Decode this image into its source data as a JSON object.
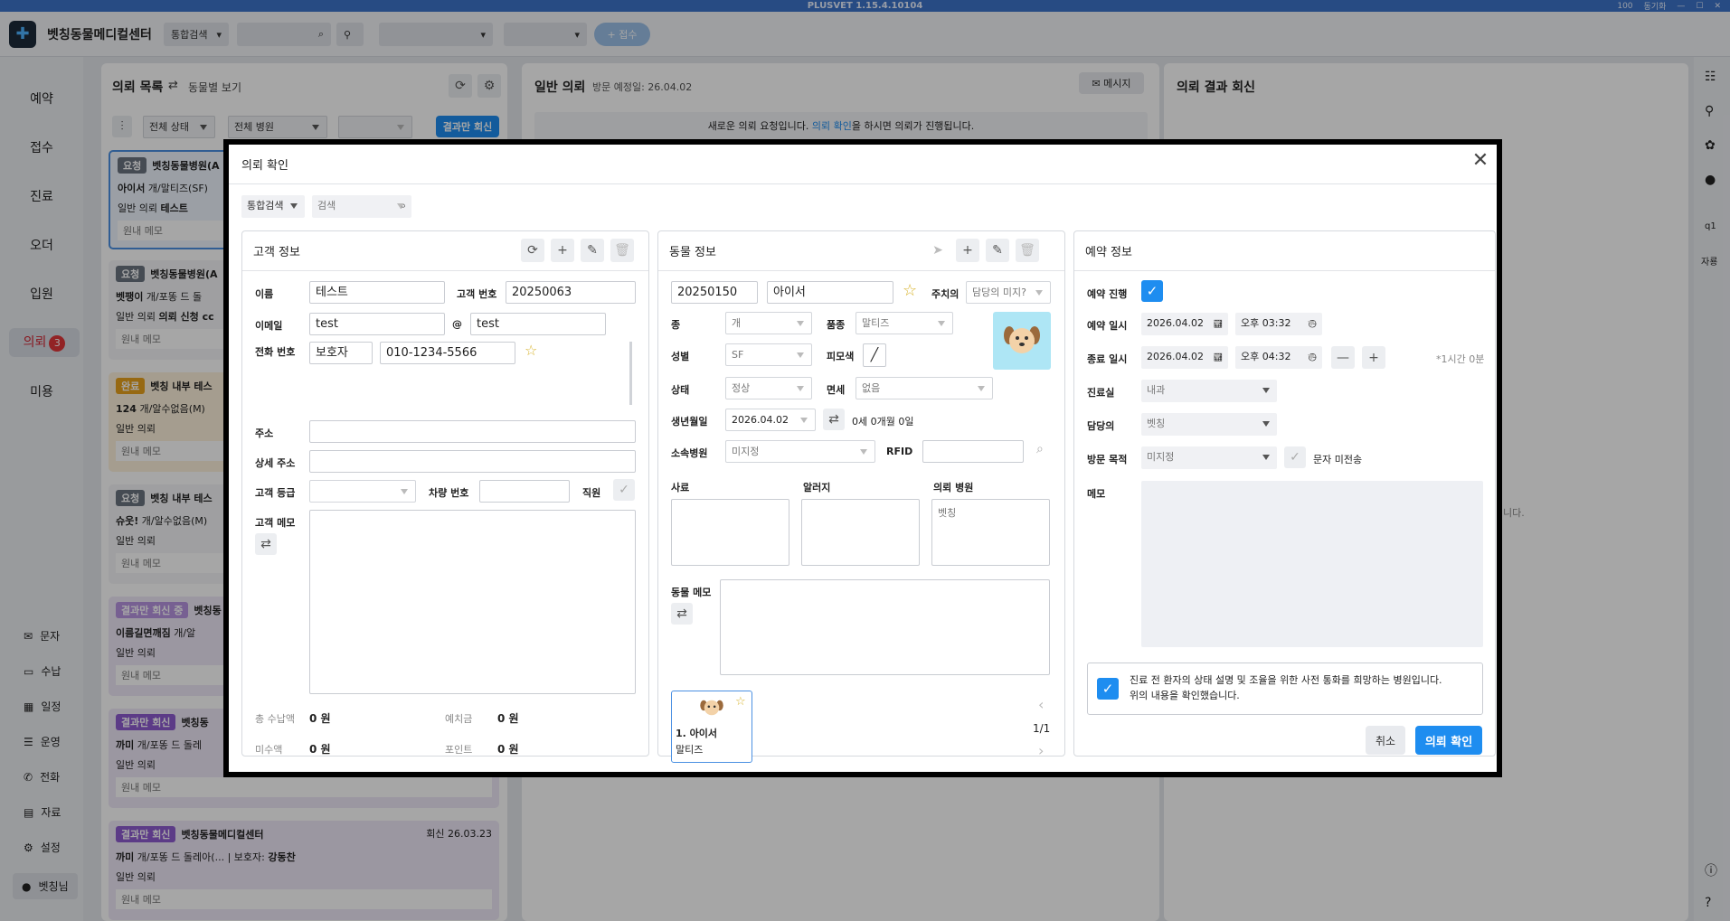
{
  "titlebar": {
    "title": "PLUSVET 1.15.4.10104",
    "zoom": "100",
    "right_items": [
      "동기화",
      "커뮤",
      "커뮤"
    ]
  },
  "topbar": {
    "app_name": "벳칭동물메디컬센터",
    "search_scope": "통합검색",
    "reception_button": "+ 접수"
  },
  "leftnav": {
    "items": [
      "예약",
      "접수",
      "진료",
      "오더",
      "입원",
      "의뢰",
      "미용"
    ],
    "referral_badge": "3",
    "sub_items": [
      "문자",
      "수납",
      "일정",
      "운영",
      "전화",
      "자료",
      "설정",
      "벳칭님"
    ]
  },
  "list_panel": {
    "title": "의뢰 목록",
    "toggle_label": "동물별 보기",
    "status_filter": "전체 상태",
    "hospital_filter": "전체 병원",
    "result_only_button": "결과만 회신",
    "cards": [
      {
        "tag": "요청",
        "hospital": "벳칭동물병원(A",
        "animal": "아이서",
        "breed": "개/말티즈(SF)",
        "type": "일반 의뢰",
        "note": "테스트",
        "memo": "원내 메모"
      },
      {
        "tag": "요청",
        "hospital": "벳칭동물병원(A",
        "animal": "벳팽이",
        "breed": "개/포똥 드 돌",
        "type": "일반 의뢰",
        "note": "의뢰 신청 cc",
        "memo": "원내 메모"
      },
      {
        "tag": "완료",
        "hospital": "벳칭 내부 테스",
        "animal": "124",
        "breed": "개/알수없음(M)",
        "type": "일반 의뢰",
        "note": "",
        "memo": "원내 메모"
      },
      {
        "tag": "요청",
        "hospital": "벳칭 내부 테스",
        "animal": "슈웃!",
        "breed": "개/알수없음(M)",
        "type": "일반 의뢰",
        "note": "",
        "memo": "원내 메모"
      },
      {
        "tag": "결과만 회신 중",
        "hospital": "벳칭동",
        "animal": "이름길면깨짐",
        "breed": "개/알",
        "type": "일반 의뢰",
        "note": "",
        "memo": "원내 메모"
      },
      {
        "tag": "결과만 회신",
        "hospital": "벳칭동",
        "animal": "까미",
        "breed": "개/포똥 드 돌레",
        "type": "일반 의뢰",
        "note": "",
        "memo": "원내 메모"
      },
      {
        "tag": "결과만 회신",
        "hospital": "벳칭동물메디컬센터",
        "animal": "까미",
        "breed": "개/포똥 드 돌레아(...",
        "guardian_label": "보호자:",
        "guardian": "강동찬",
        "reply": "회신 26.03.23",
        "type": "일반 의뢰",
        "memo": "원내 메모"
      }
    ]
  },
  "middle_panel": {
    "title": "일반 의뢰",
    "visit_date": "방문 예정일: 26.04.02",
    "message_button": "메시지",
    "notice_pre": "새로운 의뢰 요청입니다. ",
    "notice_link": "의뢰 확인",
    "notice_post": "을 하시면 의뢰가 진행됩니다."
  },
  "right_panel": {
    "title": "의뢰 결과 회신",
    "trailing_text": "니다."
  },
  "right_rail": {
    "items": [
      "q1",
      "자룡"
    ]
  },
  "modal": {
    "title": "의뢰 확인",
    "search_scope": "통합검색",
    "search_placeholder": "검색",
    "customer": {
      "title": "고객 정보",
      "name_label": "이름",
      "name": "테스트",
      "number_label": "고객 번호",
      "number": "20250063",
      "email_label": "이메일",
      "email_user": "test",
      "at": "@",
      "email_domain": "test",
      "phone_label": "전화 번호",
      "phone_type": "보호자",
      "phone": "010-1234-5566",
      "address_label": "주소",
      "detail_address_label": "상세 주소",
      "grade_label": "고객 등급",
      "car_label": "차량 번호",
      "staff_label": "직원",
      "memo_label": "고객 메모",
      "total_paid_label": "총 수납액",
      "total_paid": "0 원",
      "deposit_label": "예치금",
      "deposit": "0 원",
      "unpaid_label": "미수액",
      "unpaid": "0 원",
      "point_label": "포인트",
      "point": "0 원"
    },
    "animal": {
      "title": "동물 정보",
      "chart_no": "20250150",
      "name": "아이서",
      "doctor_label": "주치의",
      "doctor": "담당의 미지?",
      "species_label": "종",
      "species": "개",
      "breed_label": "품종",
      "breed": "말티즈",
      "sex_label": "성별",
      "sex": "SF",
      "coat_label": "피모색",
      "status_label": "상태",
      "status": "정상",
      "immunity_label": "면세",
      "immunity": "없음",
      "birth_label": "생년월일",
      "birth": "2026.04.02",
      "age": "0세 0개월 0일",
      "hospital_label": "소속병원",
      "hospital": "미지정",
      "rfid_label": "RFID",
      "food_label": "사료",
      "allergy_label": "알러지",
      "ref_hospital_label": "의뢰 병원",
      "ref_hospital": "벳칭",
      "memo_label": "동물 메모",
      "card_name": "1. 아이서",
      "card_breed": "말티즈",
      "pager": "1/1"
    },
    "reservation": {
      "title": "예약 정보",
      "progress_label": "예약 진행",
      "date_label": "예약 일시",
      "date": "2026.04.02",
      "time": "오후 03:32",
      "end_label": "종료 일시",
      "end_date": "2026.04.02",
      "end_time": "오후 04:32",
      "duration": "*1시간 0분",
      "room_label": "진료실",
      "room": "내과",
      "doctor_label": "담당의",
      "doctor": "벳칭",
      "purpose_label": "방문 목적",
      "purpose": "미지정",
      "sms_label": "문자 미전송",
      "memo_label": "메모",
      "consent_line1": "진료 전 환자의 상태 설명 및 조율을 위한 사전 통화를 희망하는 병원입니다.",
      "consent_line2": "위의 내용을 확인했습니다."
    },
    "cancel_button": "취소",
    "confirm_button": "의뢰 확인"
  },
  "colors": {
    "accent": "#1e8df0",
    "titlebar": "#3d74c9",
    "badge": "#e0373a"
  }
}
